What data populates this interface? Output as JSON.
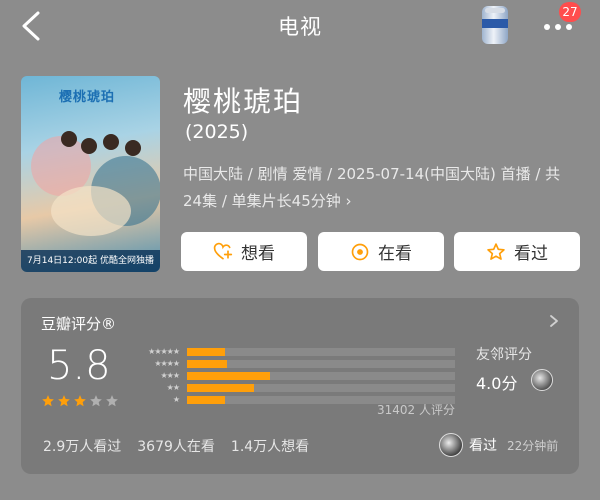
{
  "header": {
    "title": "电视",
    "notification_count": "27"
  },
  "poster": {
    "title_art": "樱桃琥珀",
    "bottom_text": "7月14日12:00起 优酷全网独播"
  },
  "show": {
    "title": "樱桃琥珀",
    "year": "(2025)",
    "meta": "中国大陆 / 剧情 爱情 / 2025-07-14(中国大陆) 首播 / 共24集 / 单集片长45分钟 ›"
  },
  "actions": [
    {
      "label": "想看",
      "icon": "heart-plus-icon"
    },
    {
      "label": "在看",
      "icon": "target-icon"
    },
    {
      "label": "看过",
      "icon": "star-outline-icon"
    }
  ],
  "rating": {
    "title": "豆瓣评分®",
    "score": "5.8",
    "stars_filled": 3,
    "stars_total": 5,
    "distribution": [
      {
        "stars": "★★★★★",
        "fraction": 0.14
      },
      {
        "stars": "★★★★",
        "fraction": 0.15
      },
      {
        "stars": "★★★",
        "fraction": 0.31
      },
      {
        "stars": "★★",
        "fraction": 0.25
      },
      {
        "stars": "★",
        "fraction": 0.14
      }
    ],
    "count": "31402 人评分",
    "friend_label": "友邻评分",
    "friend_score": "4.0分",
    "stats": [
      "2.9万人看过",
      "3679人在看",
      "1.4万人想看"
    ],
    "my_status": "看过",
    "my_time": "22分钟前"
  },
  "colors": {
    "background": "#8c8c8c",
    "card": "#7a7a7a",
    "accent": "#ff9f0a",
    "badge": "#ff4d4d"
  }
}
